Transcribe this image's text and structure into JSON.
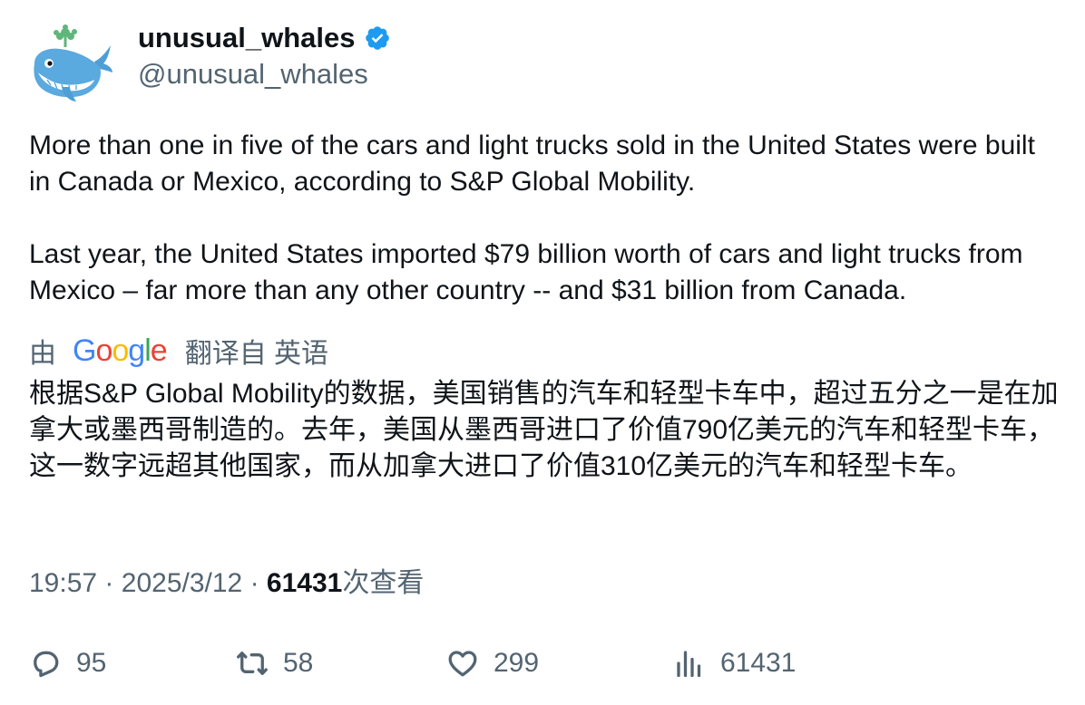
{
  "author": {
    "display_name": "unusual_whales",
    "handle": "@unusual_whales",
    "verified_icon": "verified-badge-icon",
    "avatar_icon": "whale-avatar"
  },
  "tweet": {
    "text": "More than one in five of the cars and light trucks sold in the United States were built in Canada or Mexico, according to S&P Global Mobility.\n\nLast year, the United States imported $79 billion worth of cars and light trucks from Mexico – far more than any other country -- and $31 billion from Canada."
  },
  "translation": {
    "prefix": "由",
    "service": "Google",
    "suffix": "翻译自 英语",
    "text": "根据S&P Global Mobility的数据，美国销售的汽车和轻型卡车中，超过五分之一是在加拿大或墨西哥制造的。去年，美国从墨西哥进口了价值790亿美元的汽车和轻型卡车，这一数字远超其他国家，而从加拿大进口了价值310亿美元的汽车和轻型卡车。"
  },
  "meta": {
    "time": "19:57",
    "separator": "·",
    "date": "2025/3/12",
    "views_count": "61431",
    "views_label": "次查看"
  },
  "actions": {
    "replies": "95",
    "retweets": "58",
    "likes": "299",
    "views": "61431"
  },
  "colors": {
    "text": "#0f1419",
    "secondary": "#536471",
    "verified": "#1d9bf0",
    "google_blue": "#4285f4",
    "google_red": "#ea4335",
    "google_yellow": "#fbbc05",
    "google_green": "#34a853"
  }
}
